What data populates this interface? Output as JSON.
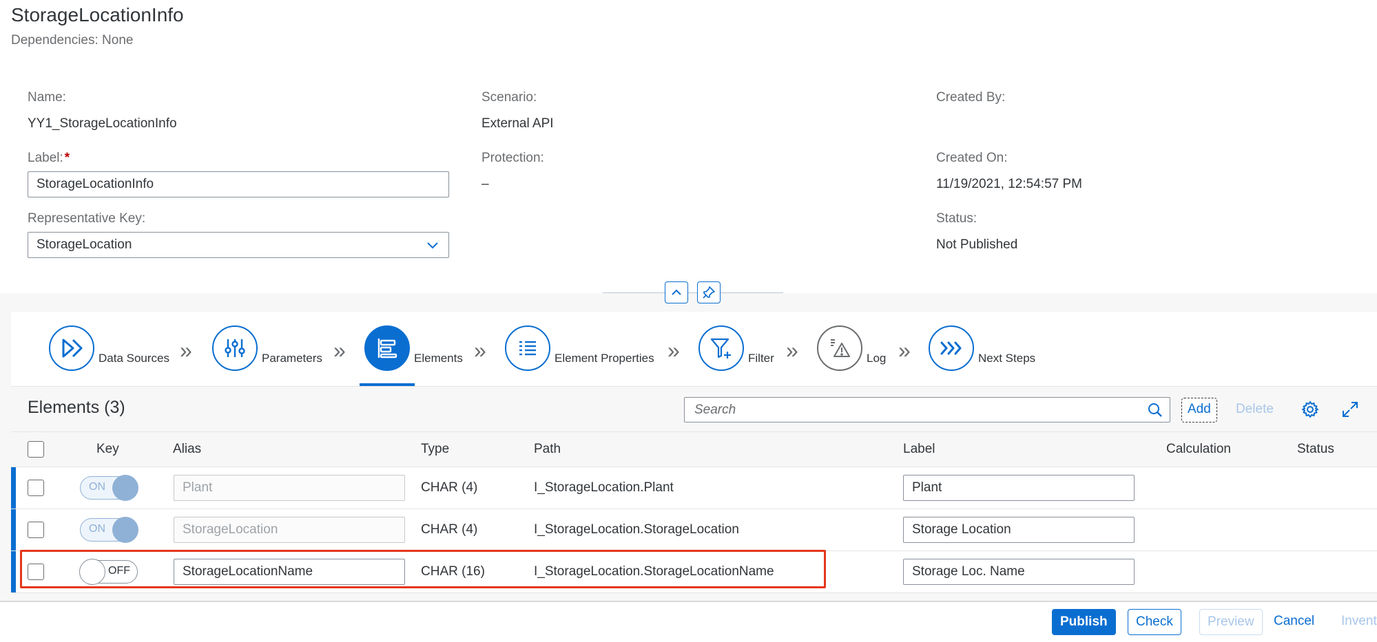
{
  "page": {
    "title": "StorageLocationInfo",
    "subtitle": "Dependencies: None"
  },
  "fields": {
    "name_label": "Name:",
    "name_value": "YY1_StorageLocationInfo",
    "label_label": "Label:",
    "label_required": "*",
    "label_value": "StorageLocationInfo",
    "repkey_label": "Representative Key:",
    "repkey_value": "StorageLocation",
    "scenario_label": "Scenario:",
    "scenario_value": "External API",
    "protection_label": "Protection:",
    "protection_value": "–",
    "createdby_label": "Created By:",
    "createdon_label": "Created On:",
    "createdon_value": "11/19/2021, 12:54:57 PM",
    "status_label": "Status:",
    "status_value": "Not Published"
  },
  "wizard": {
    "steps": [
      {
        "label": "Data Sources",
        "icon": "double-play-icon"
      },
      {
        "label": "Parameters",
        "icon": "sliders-icon"
      },
      {
        "label": "Elements",
        "icon": "elements-icon",
        "active": true
      },
      {
        "label": "Element Properties",
        "icon": "list-icon"
      },
      {
        "label": "Filter",
        "icon": "filter-add-icon"
      },
      {
        "label": "Log",
        "icon": "log-warning-icon"
      },
      {
        "label": "Next Steps",
        "icon": "triple-chevron-icon"
      }
    ],
    "separator": "»"
  },
  "elements": {
    "title": "Elements (3)",
    "search_placeholder": "Search",
    "add_label": "Add",
    "delete_label": "Delete",
    "columns": [
      "Key",
      "Alias",
      "Type",
      "Path",
      "Label",
      "Calculation",
      "Status"
    ],
    "rows": [
      {
        "key": "ON",
        "alias": "Plant",
        "type": "CHAR (4)",
        "path": "I_StorageLocation.Plant",
        "label": "Plant"
      },
      {
        "key": "ON",
        "alias": "StorageLocation",
        "type": "CHAR (4)",
        "path": "I_StorageLocation.StorageLocation",
        "label": "Storage Location"
      },
      {
        "key": "OFF",
        "alias": "StorageLocationName",
        "type": "CHAR (16)",
        "path": "I_StorageLocation.StorageLocationName",
        "label": "Storage Loc. Name"
      }
    ]
  },
  "footer": {
    "publish": "Publish",
    "check": "Check",
    "preview": "Preview",
    "cancel": "Cancel",
    "invent": "Invent"
  },
  "colors": {
    "accent": "#0a6ed1",
    "highlight": "#e4361b",
    "required": "#bb0000"
  }
}
